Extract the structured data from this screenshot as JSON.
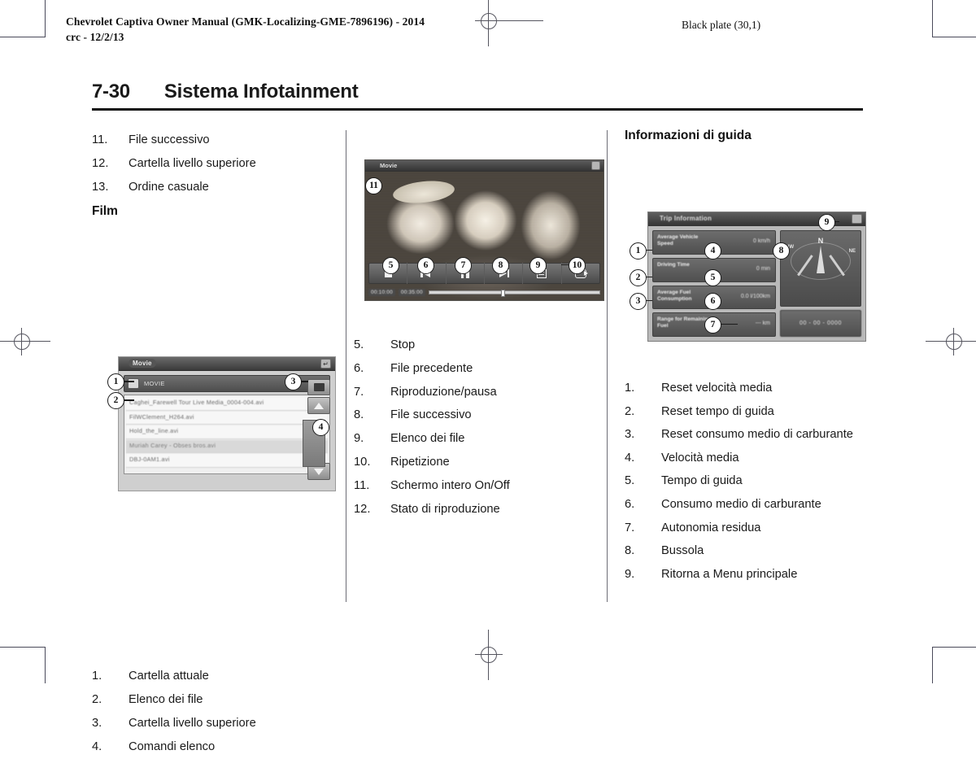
{
  "header": {
    "left_line1": "Chevrolet Captiva Owner Manual (GMK-Localizing-GME-7896196) - 2014",
    "left_line2": "crc - 12/2/13",
    "right": "Black plate (30,1)"
  },
  "page_title": {
    "number": "7-30",
    "text": "Sistema Infotainment"
  },
  "col1": {
    "continued_items": [
      {
        "n": "11.",
        "label": "File successivo"
      },
      {
        "n": "12.",
        "label": "Cartella livello superiore"
      },
      {
        "n": "13.",
        "label": "Ordine casuale"
      }
    ],
    "sub_heading": "Film",
    "figure": {
      "name": "movie-file-list-screenshot",
      "titlebar_label": "Movie",
      "titlebar_button": "return-icon",
      "path_label": "MOVIE",
      "files": [
        "Caghei_Farewell Tour Live Media_0004-004.avi",
        "FilWClement_H264.avi",
        "Hold_the_line.avi",
        "Muriah Carey - Obses bros.avi",
        "DBJ-0AM1.avi"
      ],
      "callouts": [
        "1",
        "2",
        "3",
        "4"
      ],
      "side_buttons": [
        "folder-up-icon",
        "scroll-up-icon",
        "scroll-down-icon"
      ]
    },
    "items": [
      {
        "n": "1.",
        "label": "Cartella attuale"
      },
      {
        "n": "2.",
        "label": "Elenco dei file"
      },
      {
        "n": "3.",
        "label": "Cartella livello superiore"
      },
      {
        "n": "4.",
        "label": "Comandi elenco"
      }
    ]
  },
  "col2": {
    "figure": {
      "name": "movie-playback-screenshot",
      "titlebar_label": "Movie",
      "titlebar_button": "return-icon",
      "callouts": [
        "5",
        "6",
        "7",
        "8",
        "9",
        "10",
        "11"
      ],
      "controls": [
        "stop-icon",
        "previous-track-icon",
        "pause-icon",
        "next-track-icon",
        "file-list-icon",
        "repeat-icon"
      ],
      "time_elapsed": "00:10:00",
      "time_total": "00:35:00"
    },
    "items": [
      {
        "n": "5.",
        "label": "Stop"
      },
      {
        "n": "6.",
        "label": "File precedente"
      },
      {
        "n": "7.",
        "label": "Riproduzione/pausa"
      },
      {
        "n": "8.",
        "label": "File successivo"
      },
      {
        "n": "9.",
        "label": "Elenco dei file"
      },
      {
        "n": "10.",
        "label": "Ripetizione"
      },
      {
        "n": "11.",
        "label": "Schermo intero On/Off"
      },
      {
        "n": "12.",
        "label": "Stato di riproduzione"
      }
    ]
  },
  "col3": {
    "section_heading": "Informazioni di guida",
    "figure": {
      "name": "trip-information-screenshot",
      "titlebar_label": "Trip Information",
      "titlebar_button": "return-icon",
      "rows": [
        {
          "label": "Average Vehicle Speed",
          "value": "0   km/h"
        },
        {
          "label": "Driving Time",
          "value": "0 min"
        },
        {
          "label": "Average Fuel Consumption",
          "value": "0.0  l/100km"
        },
        {
          "label": "Range for Remaining Fuel",
          "value": "---  km"
        }
      ],
      "compass": {
        "north": "N",
        "northwest": "NW",
        "northeast": "NE"
      },
      "date": "00 - 00 - 0000",
      "callouts": [
        "1",
        "2",
        "3",
        "4",
        "5",
        "6",
        "7",
        "8",
        "9"
      ]
    },
    "items": [
      {
        "n": "1.",
        "label": "Reset velocità media"
      },
      {
        "n": "2.",
        "label": "Reset tempo di guida"
      },
      {
        "n": "3.",
        "label": "Reset consumo medio di carburante"
      },
      {
        "n": "4.",
        "label": "Velocità media"
      },
      {
        "n": "5.",
        "label": "Tempo di guida"
      },
      {
        "n": "6.",
        "label": "Consumo medio di carburante"
      },
      {
        "n": "7.",
        "label": "Autonomia residua"
      },
      {
        "n": "8.",
        "label": "Bussola"
      },
      {
        "n": "9.",
        "label": "Ritorna a Menu principale"
      }
    ]
  }
}
